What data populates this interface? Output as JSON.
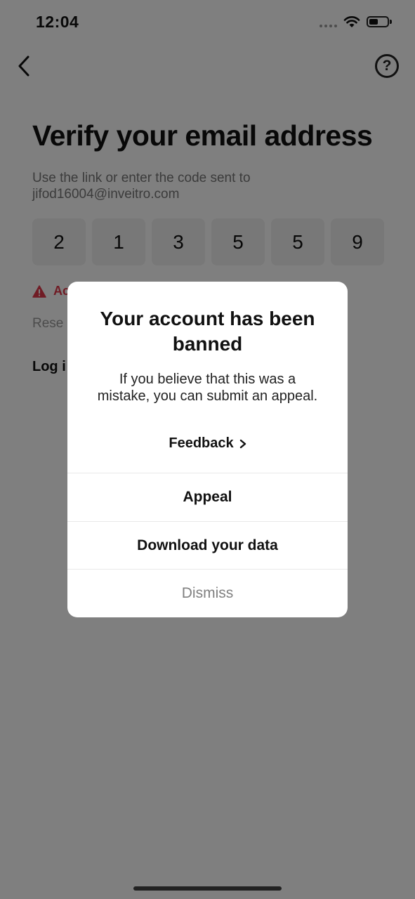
{
  "status_bar": {
    "time": "12:04"
  },
  "header": {
    "help_symbol": "?"
  },
  "page": {
    "title": "Verify your email address",
    "subtitle_line1": "Use the link or enter the code sent to",
    "subtitle_line2": "jifod16004@inveitro.com",
    "code_digits": [
      "2",
      "1",
      "3",
      "5",
      "5",
      "9"
    ],
    "error_text": "Ac",
    "resend_text": "Rese",
    "login_text": "Log i"
  },
  "dialog": {
    "title": "Your account has been banned",
    "message": "If you believe that this was a mistake, you can submit an appeal.",
    "feedback_label": "Feedback",
    "appeal_label": "Appeal",
    "download_label": "Download your data",
    "dismiss_label": "Dismiss"
  },
  "colors": {
    "error": "#e0384a",
    "overlay": "rgba(0,0,0,0.5)"
  }
}
